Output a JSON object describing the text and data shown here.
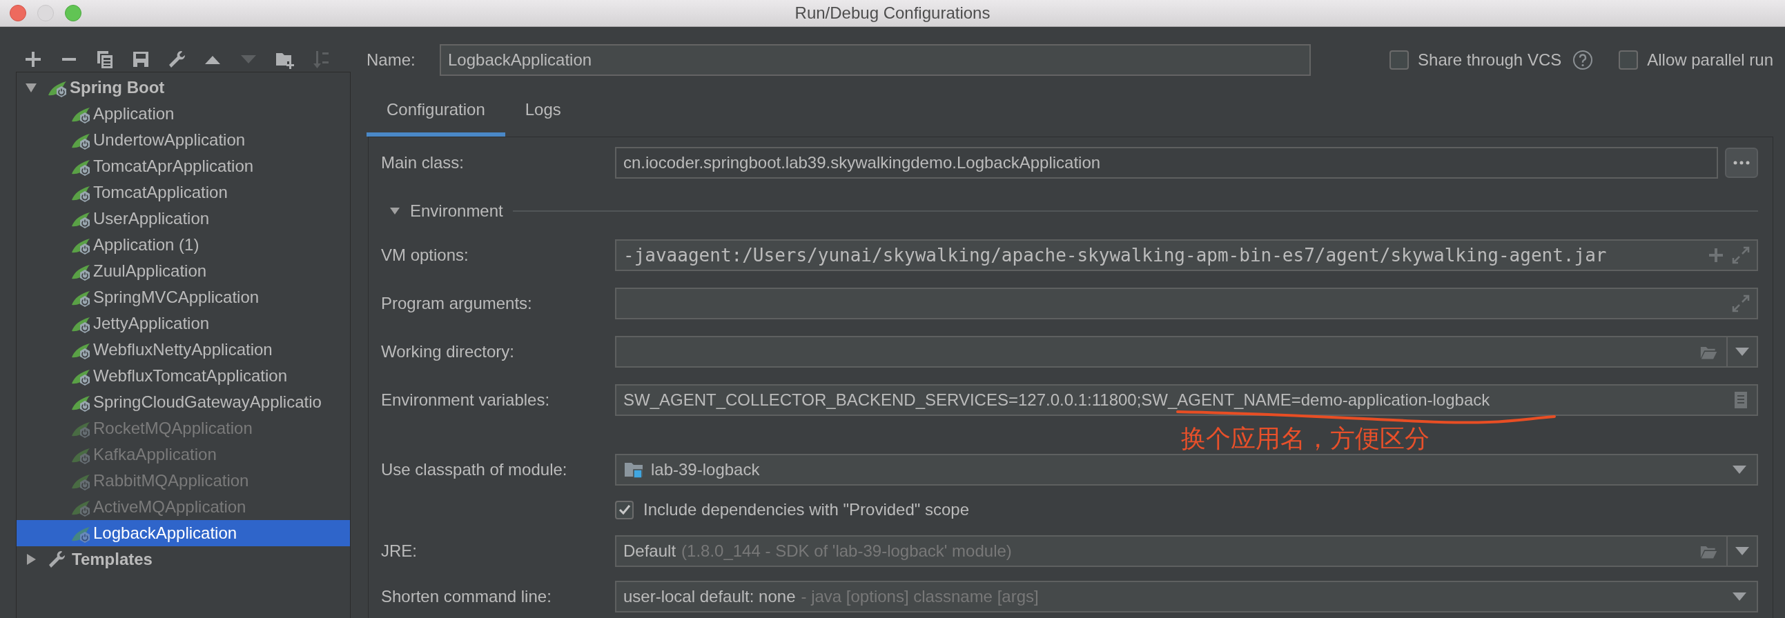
{
  "window": {
    "title": "Run/Debug Configurations"
  },
  "window_controls": [
    {
      "kind": "close",
      "disabled": false
    },
    {
      "kind": "minimize",
      "disabled": true
    },
    {
      "kind": "zoom",
      "disabled": false
    }
  ],
  "toolbar": [
    {
      "kind": "add",
      "disabled": false
    },
    {
      "kind": "remove",
      "disabled": false
    },
    {
      "kind": "copy",
      "disabled": false
    },
    {
      "kind": "save",
      "disabled": false
    },
    {
      "kind": "wrench",
      "disabled": false
    },
    {
      "kind": "up",
      "disabled": false
    },
    {
      "kind": "down",
      "disabled": true
    },
    {
      "kind": "new-folder",
      "disabled": false
    },
    {
      "kind": "sort",
      "disabled": true
    }
  ],
  "tree": [
    {
      "label": "Spring Boot",
      "kind": "spring",
      "expanded": true,
      "selected": false,
      "children": [
        {
          "label": "Application",
          "disabled": false,
          "selected": false
        },
        {
          "label": "UndertowApplication",
          "disabled": false,
          "selected": false
        },
        {
          "label": "TomcatAprApplication",
          "disabled": false,
          "selected": false
        },
        {
          "label": "TomcatApplication",
          "disabled": false,
          "selected": false
        },
        {
          "label": "UserApplication",
          "disabled": false,
          "selected": false
        },
        {
          "label": "Application (1)",
          "disabled": false,
          "selected": false
        },
        {
          "label": "ZuulApplication",
          "disabled": false,
          "selected": false
        },
        {
          "label": "SpringMVCApplication",
          "disabled": false,
          "selected": false
        },
        {
          "label": "JettyApplication",
          "disabled": false,
          "selected": false
        },
        {
          "label": "WebfluxNettyApplication",
          "disabled": false,
          "selected": false
        },
        {
          "label": "WebfluxTomcatApplication",
          "disabled": false,
          "selected": false
        },
        {
          "label": "SpringCloudGatewayApplicatio",
          "disabled": false,
          "selected": false
        },
        {
          "label": "RocketMQApplication",
          "disabled": true,
          "selected": false
        },
        {
          "label": "KafkaApplication",
          "disabled": true,
          "selected": false
        },
        {
          "label": "RabbitMQApplication",
          "disabled": true,
          "selected": false
        },
        {
          "label": "ActiveMQApplication",
          "disabled": true,
          "selected": false
        },
        {
          "label": "LogbackApplication",
          "disabled": false,
          "selected": true
        }
      ]
    },
    {
      "label": "Templates",
      "kind": "templates",
      "expanded": false,
      "selected": false
    }
  ],
  "name": {
    "label": "Name:",
    "value": "LogbackApplication"
  },
  "options": [
    {
      "label": "Share through VCS",
      "checked": false,
      "help": true
    },
    {
      "label": "Allow parallel run",
      "checked": false
    }
  ],
  "tabs": [
    {
      "label": "Configuration",
      "selected": true
    },
    {
      "label": "Logs",
      "selected": false
    }
  ],
  "form": [
    {
      "kind": "browse",
      "label": "Main class:",
      "value": "cn.iocoder.springboot.lab39.skywalkingdemo.LogbackApplication"
    },
    {
      "kind": "section",
      "label": "Environment",
      "expanded": true
    },
    {
      "kind": "mono",
      "label": "VM options:",
      "value": "-javaagent:/Users/yunai/skywalking/apache-skywalking-apm-bin-es7/agent/skywalking-agent.jar"
    },
    {
      "kind": "expand",
      "label": "Program arguments:"
    },
    {
      "kind": "path",
      "label": "Working directory:"
    },
    {
      "kind": "env",
      "label": "Environment variables:",
      "value": "SW_AGENT_COLLECTOR_BACKEND_SERVICES=127.0.0.1:11800;SW_AGENT_NAME=demo-application-logback"
    },
    {
      "kind": "module",
      "label": "Use classpath of module:",
      "value": "lab-39-logback"
    },
    {
      "kind": "checkbox",
      "label": "Include dependencies with \"Provided\" scope",
      "checked": true
    },
    {
      "kind": "jre",
      "label": "JRE:",
      "value": "Default",
      "hint": "(1.8.0_144 - SDK of 'lab-39-logback' module)"
    },
    {
      "kind": "dropdown",
      "label": "Shorten command line:",
      "value": "user-local default: none",
      "hint": "- java [options] classname [args]"
    }
  ],
  "annotation": {
    "text": "换个应用名，方便区分"
  }
}
